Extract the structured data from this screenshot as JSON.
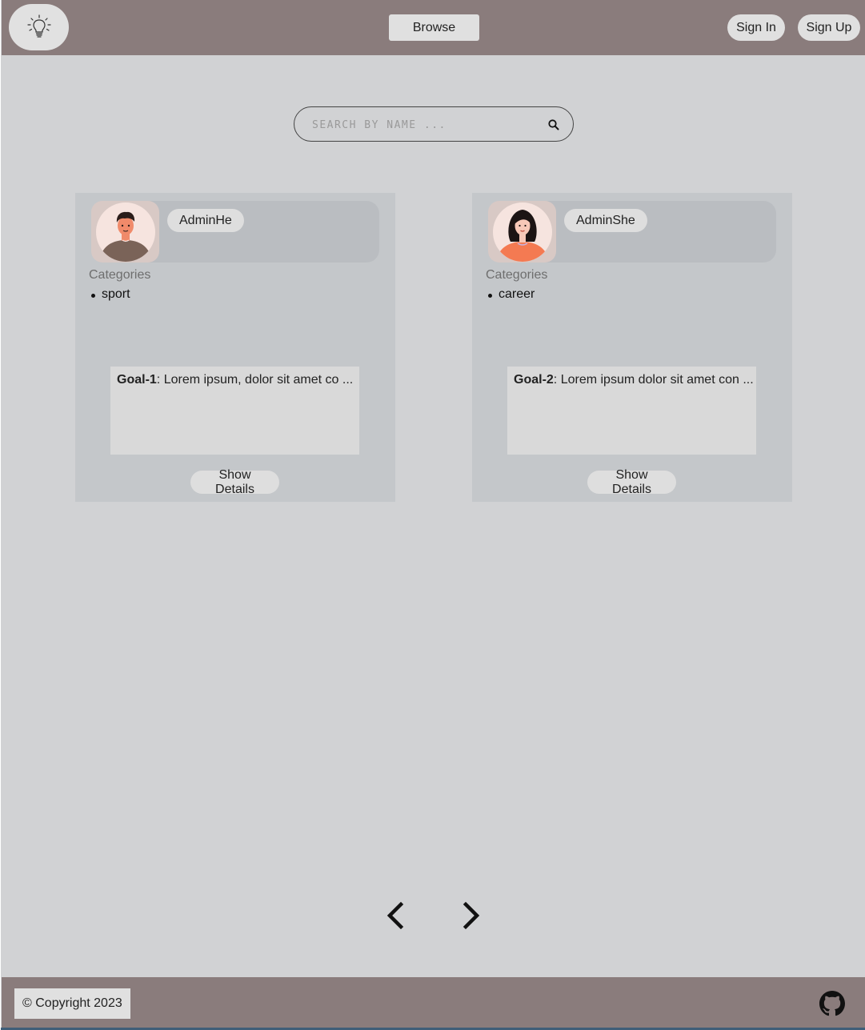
{
  "header": {
    "browse_label": "Browse",
    "sign_in_label": "Sign In",
    "sign_up_label": "Sign Up",
    "logo_icon": "lightbulb-icon"
  },
  "search": {
    "placeholder": "SEARCH BY NAME ...",
    "value": "",
    "icon": "search-icon"
  },
  "cards": [
    {
      "user_name": "AdminHe",
      "avatar_icon": "male-avatar",
      "categories_label": "Categories",
      "categories": [
        "sport"
      ],
      "goal_title": "Goal-1",
      "goal_text": ": Lorem ipsum, dolor sit amet co ...",
      "details_label": "Show Details"
    },
    {
      "user_name": "AdminShe",
      "avatar_icon": "female-avatar",
      "categories_label": "Categories",
      "categories": [
        "career"
      ],
      "goal_title": "Goal-2",
      "goal_text": ": Lorem ipsum dolor sit amet con ...",
      "details_label": "Show Details"
    }
  ],
  "pagination": {
    "prev_icon": "chevron-left-icon",
    "next_icon": "chevron-right-icon"
  },
  "footer": {
    "copyright": "© Copyright 2023",
    "github_icon": "github-icon"
  },
  "colors": {
    "header_bg": "#8a7c7c",
    "page_bg": "#d1d2d4",
    "card_bg": "#c4c7ca",
    "pill_bg": "#e0e0e0"
  }
}
